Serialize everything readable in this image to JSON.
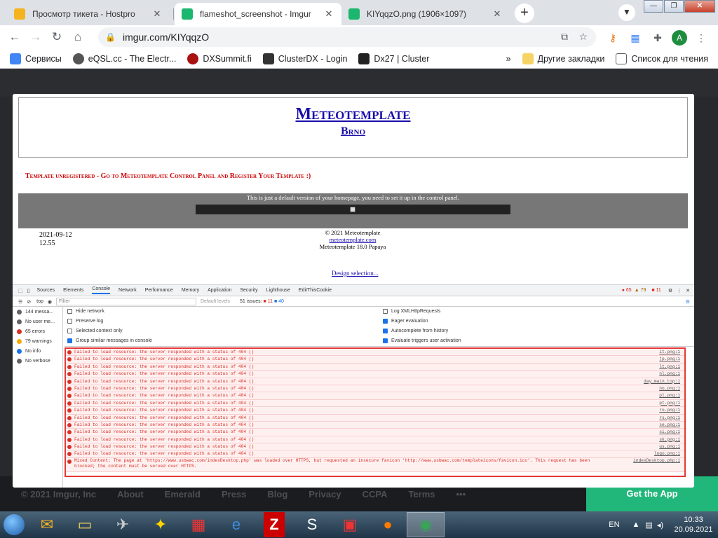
{
  "browser": {
    "tabs": [
      {
        "title": "Просмотр тикета - Hostpro",
        "color": "#f5b41e",
        "active": false
      },
      {
        "title": "flameshot_screenshot - Imgur",
        "color": "#1bb76e",
        "active": true
      },
      {
        "title": "KIYqqzO.png (1906×1097)",
        "color": "#1bb76e",
        "active": false
      }
    ],
    "new_tab": "+",
    "close_glyph": "✕",
    "url": "imgur.com/KIYqqzO",
    "profile_initial": "A",
    "bookmarks": [
      {
        "label": "Сервисы",
        "color": "#4285f4"
      },
      {
        "label": "eQSL.cc - The Electr...",
        "color": "#555"
      },
      {
        "label": "DXSummit.fi",
        "color": "#a11"
      },
      {
        "label": "ClusterDX - Login",
        "color": "#333"
      },
      {
        "label": "Dx27 | Cluster",
        "color": "#222"
      }
    ],
    "bookmarks_more": "»",
    "other_bookmarks": "Другие закладки",
    "reading_list": "Список для чтения"
  },
  "imgur_footer": [
    "© 2021 Imgur, Inc",
    "About",
    "Emerald",
    "Press",
    "Blog",
    "Privacy",
    "CCPA",
    "Terms",
    "•••"
  ],
  "imgur_get_app": "Get the App",
  "meteo": {
    "title": "Meteotemplate",
    "subtitle": "Brno",
    "warning": "Template unregistered - Go to Meteotemplate Control Panel and Register Your Template :)",
    "default_msg": "This is just a default version of your homepage, you need to set it up in the control panel.",
    "date": "2021-09-12",
    "time": "12.55",
    "copyright": "© 2021  Meteotemplate",
    "site_link": "meteotemplate.com",
    "version": "Meteotemplate 18.0 Papaya",
    "design_link": "Design selection..."
  },
  "devtools": {
    "tabs": [
      "Sources",
      "Elements",
      "Console",
      "Network",
      "Performance",
      "Memory",
      "Application",
      "Security",
      "Lighthouse",
      "EditThisCookie"
    ],
    "active_tab": "Console",
    "errors_count": "65",
    "warnings_count": "79",
    "issues_badge": "11",
    "context": "top",
    "filter_placeholder": "Filter",
    "levels": "Default levels",
    "issues_label": "51 issues:",
    "issues_err": "11",
    "issues_info": "40",
    "sidebar": [
      {
        "label": "144 messa...",
        "color": "#5f6368"
      },
      {
        "label": "No user me...",
        "color": "#5f6368"
      },
      {
        "label": "65 errors",
        "color": "#d93025"
      },
      {
        "label": "79 warnings",
        "color": "#f9ab00"
      },
      {
        "label": "No info",
        "color": "#1a73e8"
      },
      {
        "label": "No verbose",
        "color": "#5f6368"
      }
    ],
    "options_left": [
      {
        "label": "Hide network",
        "checked": false
      },
      {
        "label": "Preserve log",
        "checked": false
      },
      {
        "label": "Selected context only",
        "checked": false
      },
      {
        "label": "Group similar messages in console",
        "checked": true
      }
    ],
    "options_right": [
      {
        "label": "Log XMLHttpRequests",
        "checked": false
      },
      {
        "label": "Eager evaluation",
        "checked": true
      },
      {
        "label": "Autocomplete from history",
        "checked": true
      },
      {
        "label": "Evaluate triggers user activation",
        "checked": true
      }
    ],
    "error_text": "Failed to load resource: the server responded with a status of 404 ()",
    "error_sources": [
      "it.png:1",
      "jp.png:1",
      "lt.png:1",
      "nl.png:1",
      "day_main_top:1",
      "no.png:1",
      "pl.png:1",
      "pt.png:1",
      "ro.png:1",
      "rs.png:1",
      "se.png:1",
      "si.png:1",
      "sk.png:1",
      "us.png:1",
      "logo.png:1"
    ],
    "mixed_text": "Mixed Content: The page at 'https://www.usbwac.com/indexDesktop.php' was loaded over HTTPS, but requested an insecure favicon 'http://www.usbwac.com/templateicons/favicon.ico'. This request has been blocked; the content must be served over HTTPS.",
    "mixed_source": "indexDesktop.php:1"
  },
  "taskbar": {
    "lang": "EN",
    "time": "10:33",
    "date": "20.09.2021"
  }
}
